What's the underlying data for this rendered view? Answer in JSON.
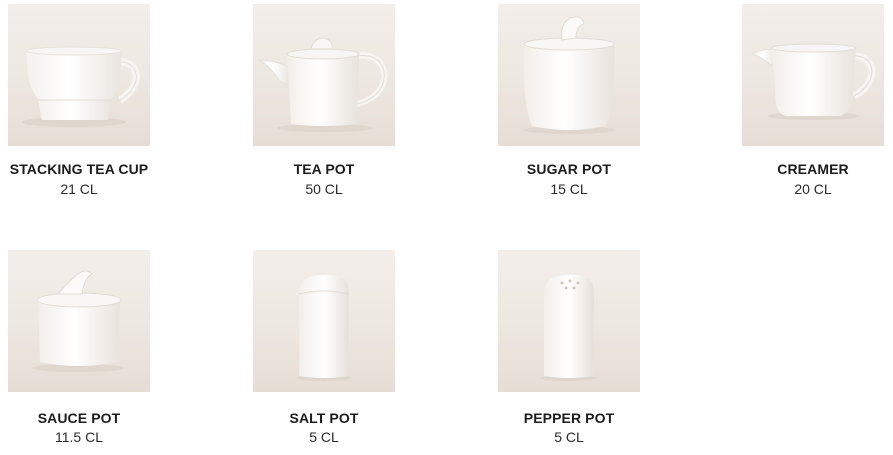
{
  "products": [
    {
      "name": "STACKING TEA CUP",
      "size": "21 CL",
      "icon": "tea-cup-icon"
    },
    {
      "name": "TEA POT",
      "size": "50 CL",
      "icon": "tea-pot-icon"
    },
    {
      "name": "SUGAR POT",
      "size": "15 CL",
      "icon": "sugar-pot-icon"
    },
    {
      "name": "CREAMER",
      "size": "20 CL",
      "icon": "creamer-icon"
    },
    {
      "name": "SAUCE POT",
      "size": "11.5 CL",
      "icon": "sauce-pot-icon"
    },
    {
      "name": "SALT POT",
      "size": "5 CL",
      "icon": "salt-shaker-icon"
    },
    {
      "name": "PEPPER POT",
      "size": "5 CL",
      "icon": "pepper-shaker-icon"
    }
  ],
  "colors": {
    "photo_background": "#ede7e1",
    "porcelain": "#ffffff",
    "text": "#1c1c1c"
  }
}
